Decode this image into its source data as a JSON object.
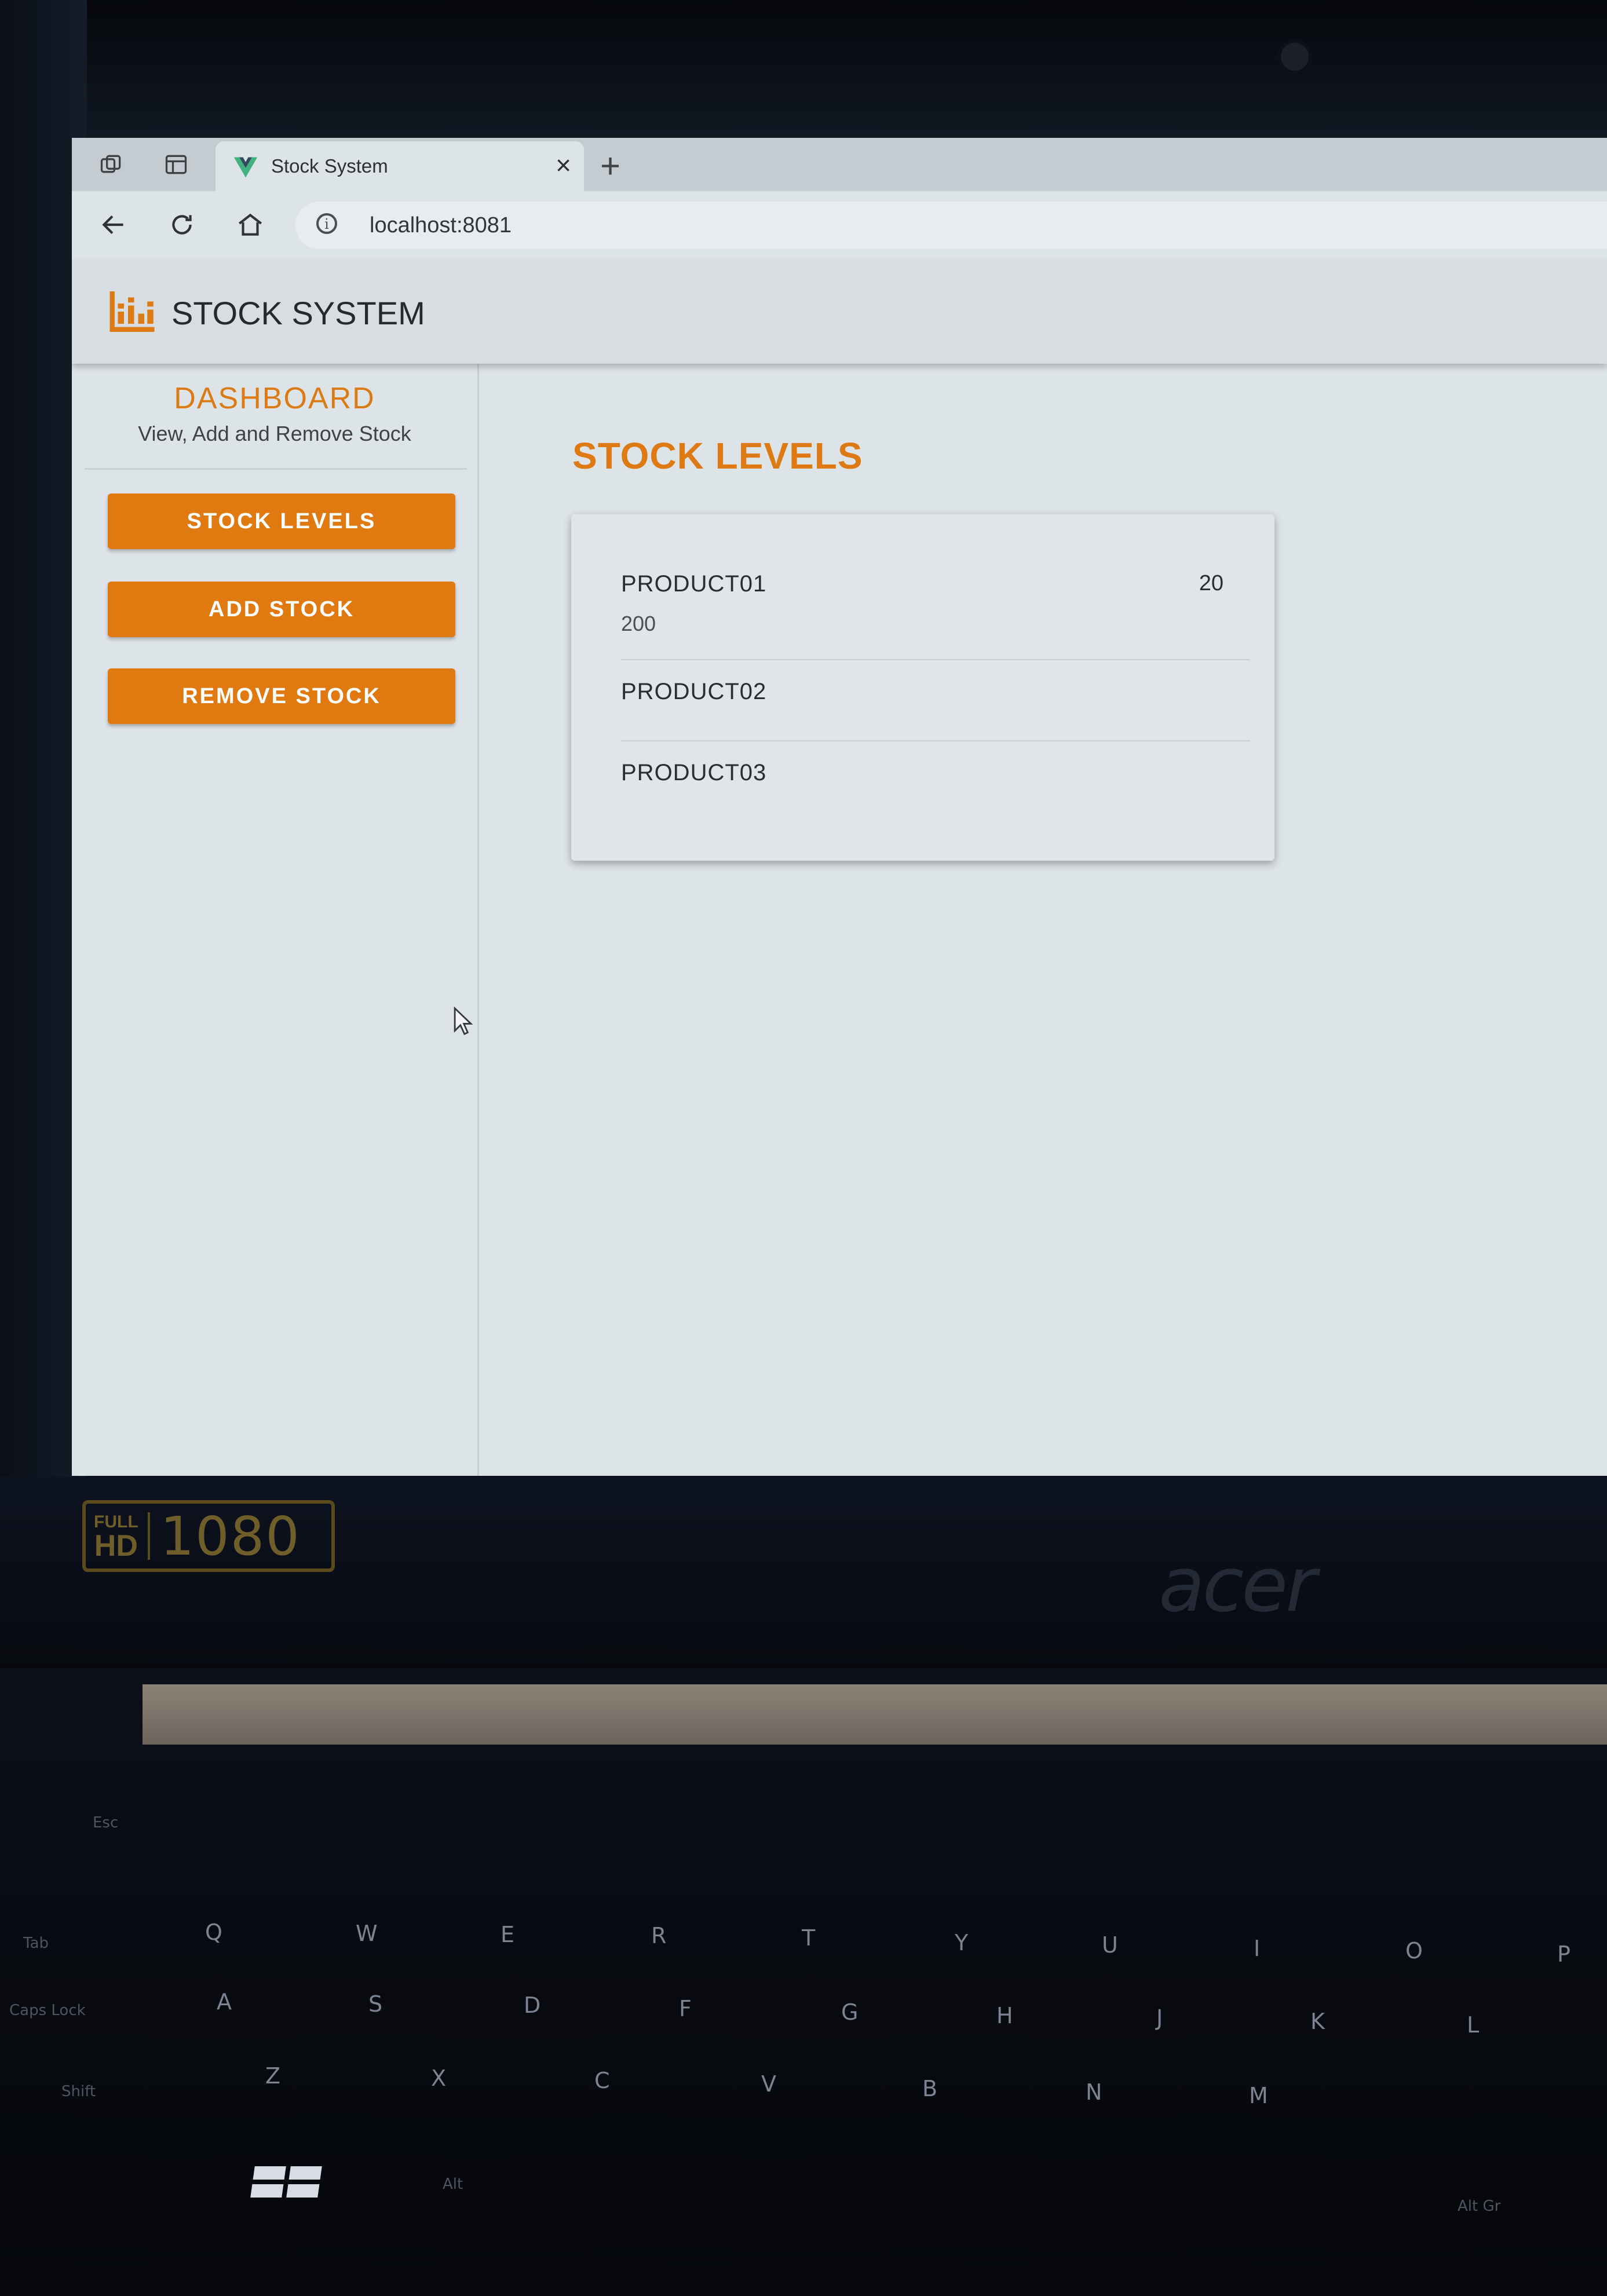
{
  "browser": {
    "tab_title": "Stock System",
    "close_glyph": "×",
    "new_tab_glyph": "+",
    "url": "localhost:8081",
    "info_glyph": "i"
  },
  "app": {
    "title": "STOCK SYSTEM",
    "logo_icon": "bar-chart-icon",
    "accent_color": "#e07a10"
  },
  "sidebar": {
    "heading": "DASHBOARD",
    "subheading": "View, Add and Remove Stock",
    "buttons": [
      {
        "label": "STOCK LEVELS"
      },
      {
        "label": "ADD STOCK"
      },
      {
        "label": "REMOVE STOCK"
      }
    ]
  },
  "main": {
    "title": "STOCK LEVELS",
    "products": [
      {
        "name": "PRODUCT01",
        "quantity": "20",
        "detail": "200"
      },
      {
        "name": "PRODUCT02",
        "quantity": "",
        "detail": ""
      },
      {
        "name": "PRODUCT03",
        "quantity": "",
        "detail": ""
      }
    ]
  },
  "device": {
    "badge_top": "FULL",
    "badge_mid": "HD",
    "badge_res": "1080",
    "brand": "acer",
    "keys": {
      "esc": "Esc",
      "tab": "Tab",
      "caps": "Caps Lock",
      "shift": "Shift",
      "alt": "Alt",
      "altgr": "Alt Gr",
      "q": "Q",
      "w": "W",
      "e": "E",
      "r": "R",
      "t": "T",
      "y": "Y",
      "u": "U",
      "i": "I",
      "o": "O",
      "p": "P",
      "a": "A",
      "s": "S",
      "d": "D",
      "f": "F",
      "g": "G",
      "h": "H",
      "j": "J",
      "k": "K",
      "l": "L",
      "z": "Z",
      "x": "X",
      "c": "C",
      "v": "V",
      "b": "B",
      "n": "N",
      "m": "M"
    }
  }
}
